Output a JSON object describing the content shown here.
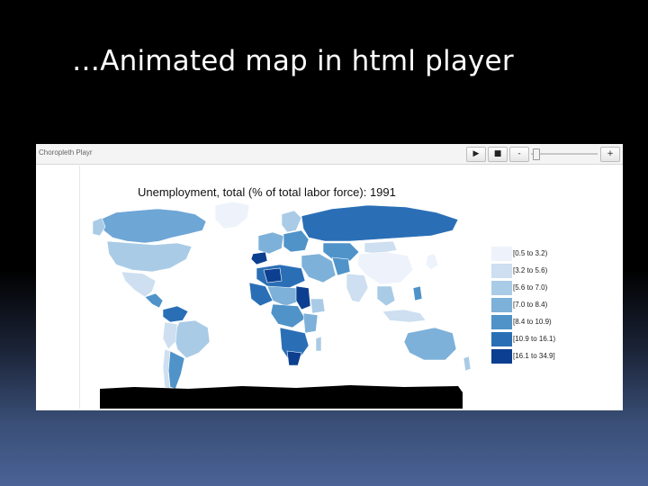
{
  "slide": {
    "title": "…Animated map in html player"
  },
  "player": {
    "app_name": "Choropleth Playr",
    "play_label": "▶",
    "stop_label": "■",
    "minus_label": "-",
    "plus_label": "+",
    "slider_position": 0.05
  },
  "map": {
    "title": "Unemployment, total (% of total labor force): 1991",
    "legend": [
      {
        "label": "[0.5 to 3.2)",
        "color": "#eef3fb"
      },
      {
        "label": "[3.2 to 5.6)",
        "color": "#cddff0"
      },
      {
        "label": "[5.6 to 7.0)",
        "color": "#a9cbe6"
      },
      {
        "label": "[7.0 to 8.4)",
        "color": "#7db1d9"
      },
      {
        "label": "[8.4 to 10.9)",
        "color": "#4f93c9"
      },
      {
        "label": "[10.9 to 16.1)",
        "color": "#2a6fb6"
      },
      {
        "label": "[16.1 to 34.9]",
        "color": "#0c3f8f"
      }
    ]
  }
}
